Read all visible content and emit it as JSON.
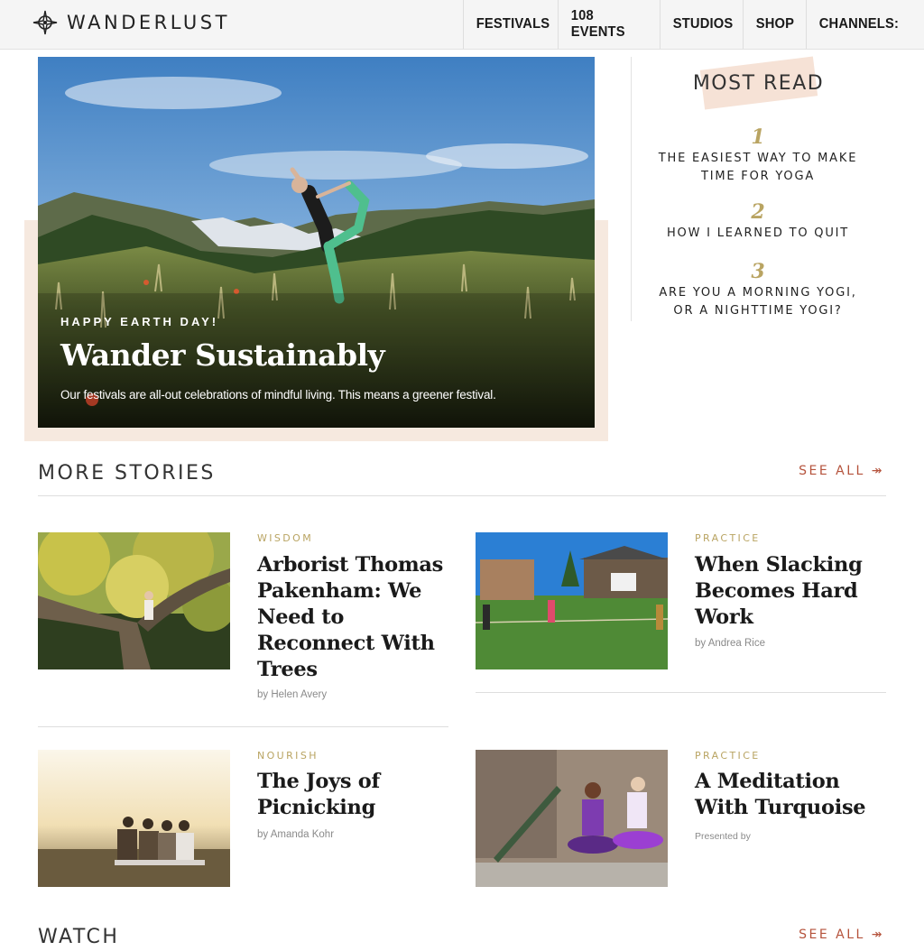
{
  "brand": {
    "name": "WANDERLUST"
  },
  "nav": {
    "items": [
      "FESTIVALS",
      "108 EVENTS",
      "STUDIOS",
      "SHOP",
      "CHANNELS:"
    ]
  },
  "hero": {
    "kicker": "HAPPY EARTH DAY!",
    "title": "Wander Sustainably",
    "description": "Our festivals are all-out celebrations of mindful living. This means a greener festival."
  },
  "most_read": {
    "title": "MOST READ",
    "items": [
      {
        "number": "1",
        "line1": "THE EASIEST WAY TO MAKE",
        "line2": "TIME FOR YOGA"
      },
      {
        "number": "2",
        "line1": "HOW I LEARNED TO QUIT",
        "line2": ""
      },
      {
        "number": "3",
        "line1": "ARE YOU A MORNING YOGI,",
        "line2": "OR A NIGHTTIME YOGI?"
      }
    ]
  },
  "more_stories": {
    "title": "MORE STORIES",
    "see_all": "SEE ALL ↠",
    "stories": [
      {
        "category": "WISDOM",
        "title_lines": [
          "Arborist Thomas",
          "Pakenham: We",
          "Need to",
          "Reconnect With",
          "Trees"
        ],
        "byline": "by Helen Avery"
      },
      {
        "category": "PRACTICE",
        "title_lines": [
          "When Slacking",
          "Becomes Hard",
          "Work"
        ],
        "byline": "by Andrea Rice"
      },
      {
        "category": "NOURISH",
        "title_lines": [
          "The Joys of",
          "Picnicking"
        ],
        "byline": "by Amanda Kohr"
      },
      {
        "category": "PRACTICE",
        "title_lines": [
          "A Meditation",
          "With Turquoise"
        ],
        "byline": "Presented by"
      }
    ]
  },
  "watch": {
    "title": "WATCH",
    "see_all": "SEE ALL ↠"
  },
  "colors": {
    "accent_gold": "#b9a462",
    "accent_rust": "#b5533c",
    "blush": "#f6e9df"
  }
}
